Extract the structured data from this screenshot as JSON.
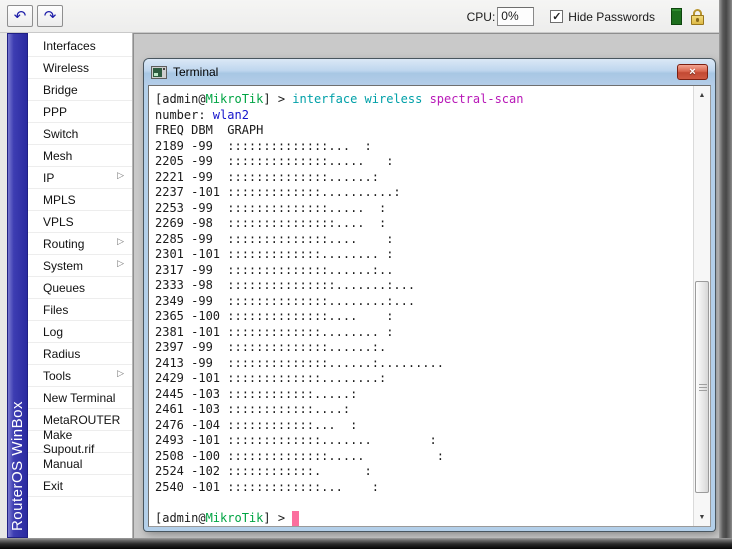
{
  "toolbar": {
    "undo_icon": "↶",
    "redo_icon": "↷",
    "cpu_label": "CPU:",
    "cpu_value": "0%",
    "hide_passwords_checked": "✓",
    "hide_passwords_label": "Hide Passwords"
  },
  "sidebar": {
    "brand": "RouterOS WinBox",
    "submenu_arrow": "▷",
    "items": [
      {
        "label": "Interfaces",
        "submenu": false
      },
      {
        "label": "Wireless",
        "submenu": false
      },
      {
        "label": "Bridge",
        "submenu": false
      },
      {
        "label": "PPP",
        "submenu": false
      },
      {
        "label": "Switch",
        "submenu": false
      },
      {
        "label": "Mesh",
        "submenu": false
      },
      {
        "label": "IP",
        "submenu": true
      },
      {
        "label": "MPLS",
        "submenu": false
      },
      {
        "label": "VPLS",
        "submenu": false
      },
      {
        "label": "Routing",
        "submenu": true
      },
      {
        "label": "System",
        "submenu": true
      },
      {
        "label": "Queues",
        "submenu": false
      },
      {
        "label": "Files",
        "submenu": false
      },
      {
        "label": "Log",
        "submenu": false
      },
      {
        "label": "Radius",
        "submenu": false
      },
      {
        "label": "Tools",
        "submenu": true
      },
      {
        "label": "New Terminal",
        "submenu": false
      },
      {
        "label": "MetaROUTER",
        "submenu": false
      },
      {
        "label": "Make Supout.rif",
        "submenu": false
      },
      {
        "label": "Manual",
        "submenu": false
      },
      {
        "label": "Exit",
        "submenu": false
      }
    ]
  },
  "terminal": {
    "title": "Terminal",
    "close_icon": "×",
    "scroll_up_icon": "▲",
    "scroll_down_icon": "▼",
    "prompt_prefix": "[admin@",
    "prompt_host": "MikroTik",
    "prompt_suffix": "] > ",
    "command_segments": [
      {
        "text": "interface wireless ",
        "role": "command"
      },
      {
        "text": "spectral-scan",
        "role": "parameter"
      }
    ],
    "number_label": "number: ",
    "number_value": "wlan2",
    "header": {
      "freq": "FREQ",
      "dbm": "DBM",
      "graph": "GRAPH"
    },
    "rows": [
      {
        "freq": "2189",
        "dbm": "-99",
        "graph": "::::::::::::::...  :"
      },
      {
        "freq": "2205",
        "dbm": "-99",
        "graph": "::::::::::::::.....   :"
      },
      {
        "freq": "2221",
        "dbm": "-99",
        "graph": "::::::::::::::......:"
      },
      {
        "freq": "2237",
        "dbm": "-101",
        "graph": ":::::::::::::..........:"
      },
      {
        "freq": "2253",
        "dbm": "-99",
        "graph": "::::::::::::::.....  :"
      },
      {
        "freq": "2269",
        "dbm": "-98",
        "graph": ":::::::::::::::....  :"
      },
      {
        "freq": "2285",
        "dbm": "-99",
        "graph": "::::::::::::::....    :"
      },
      {
        "freq": "2301",
        "dbm": "-101",
        "graph": ":::::::::::::........ :"
      },
      {
        "freq": "2317",
        "dbm": "-99",
        "graph": "::::::::::::::......:.."
      },
      {
        "freq": "2333",
        "dbm": "-98",
        "graph": ":::::::::::::::.......:..."
      },
      {
        "freq": "2349",
        "dbm": "-99",
        "graph": "::::::::::::::........:..."
      },
      {
        "freq": "2365",
        "dbm": "-100",
        "graph": "::::::::::::::....    :"
      },
      {
        "freq": "2381",
        "dbm": "-101",
        "graph": ":::::::::::::........ :"
      },
      {
        "freq": "2397",
        "dbm": "-99",
        "graph": "::::::::::::::......:."
      },
      {
        "freq": "2413",
        "dbm": "-99",
        "graph": "::::::::::::::......:........."
      },
      {
        "freq": "2429",
        "dbm": "-101",
        "graph": ":::::::::::::........:"
      },
      {
        "freq": "2445",
        "dbm": "-103",
        "graph": "::::::::::::.....:"
      },
      {
        "freq": "2461",
        "dbm": "-103",
        "graph": "::::::::::::....:"
      },
      {
        "freq": "2476",
        "dbm": "-104",
        "graph": "::::::::::::...  :"
      },
      {
        "freq": "2493",
        "dbm": "-101",
        "graph": ":::::::::::::.......        :"
      },
      {
        "freq": "2508",
        "dbm": "-100",
        "graph": "::::::::::::::.....          :"
      },
      {
        "freq": "2524",
        "dbm": "-102",
        "graph": "::::::::::::.      :"
      },
      {
        "freq": "2540",
        "dbm": "-101",
        "graph": ":::::::::::::...    :"
      }
    ],
    "colors": {
      "text": "#1a1a1a",
      "host": "#00A443",
      "command": "#00A0A8",
      "parameter": "#B818B8",
      "value": "#1414CC",
      "cursor": "#FB6E9E"
    }
  }
}
